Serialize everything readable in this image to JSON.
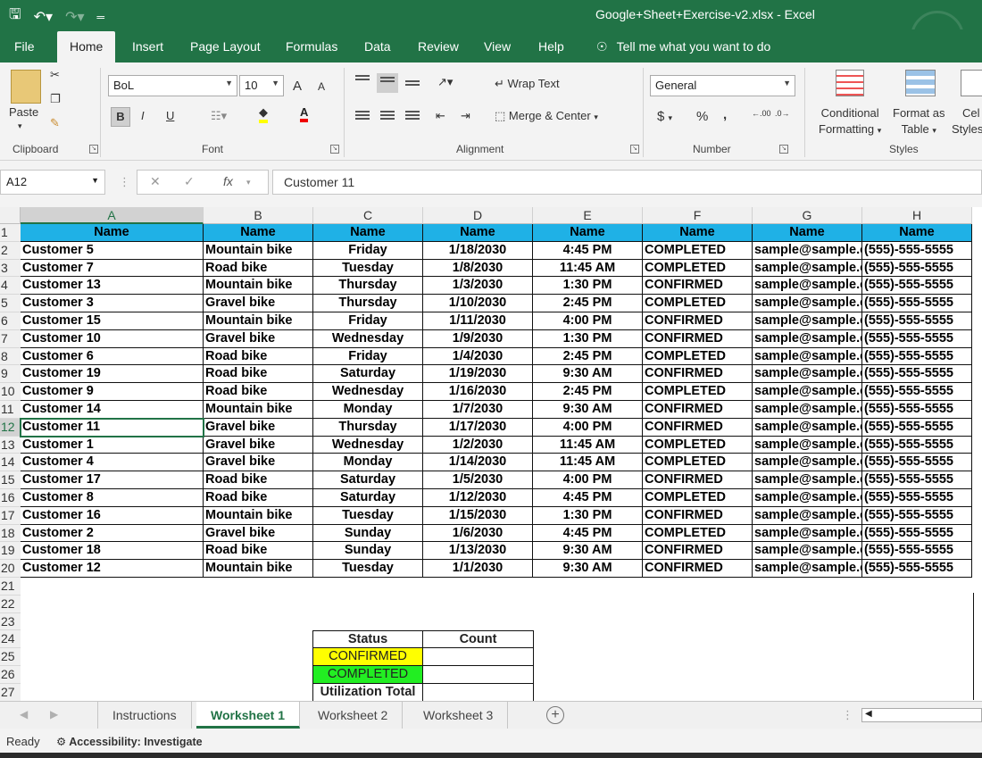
{
  "window": {
    "title": "Google+Sheet+Exercise-v2.xlsx  -  Excel"
  },
  "tabs": [
    "File",
    "Home",
    "Insert",
    "Page Layout",
    "Formulas",
    "Data",
    "Review",
    "View",
    "Help"
  ],
  "tell_me": "Tell me what you want to do",
  "ribbon": {
    "clipboard": {
      "paste": "Paste",
      "label": "Clipboard"
    },
    "font": {
      "name": "BoL",
      "size": "10",
      "label": "Font",
      "bold": "B",
      "italic": "I",
      "underline": "U",
      "grow": "A",
      "shrink": "A"
    },
    "alignment": {
      "wrap": "Wrap Text",
      "merge": "Merge & Center",
      "label": "Alignment"
    },
    "number": {
      "format": "General",
      "currency": "$",
      "percent": "%",
      "comma": ",",
      "inc": ".00",
      "dec": ".0",
      "label": "Number"
    },
    "styles": {
      "cond1": "Conditional",
      "cond2": "Formatting",
      "fmt1": "Format as",
      "fmt2": "Table",
      "cell1": "Cel",
      "cell2": "Styles",
      "label": "Styles"
    }
  },
  "formula_bar": {
    "cell_ref": "A12",
    "fx": "fx",
    "content": "Customer 11"
  },
  "columns": [
    "A",
    "B",
    "C",
    "D",
    "E",
    "F",
    "G",
    "H"
  ],
  "selected_column": "A",
  "selected_row": 12,
  "header_row": [
    "Name",
    "Name",
    "Name",
    "Name",
    "Name",
    "Name",
    "Name",
    "Name"
  ],
  "rows": [
    [
      "Customer 5",
      "Mountain bike",
      "Friday",
      "1/18/2030",
      "4:45 PM",
      "COMPLETED",
      "sample@sample.com",
      "(555)-555-5555"
    ],
    [
      "Customer 7",
      "Road bike",
      "Tuesday",
      "1/8/2030",
      "11:45 AM",
      "COMPLETED",
      "sample@sample.com",
      "(555)-555-5555"
    ],
    [
      "Customer 13",
      "Mountain bike",
      "Thursday",
      "1/3/2030",
      "1:30 PM",
      "CONFIRMED",
      "sample@sample.com",
      "(555)-555-5555"
    ],
    [
      "Customer 3",
      "Gravel bike",
      "Thursday",
      "1/10/2030",
      "2:45 PM",
      "COMPLETED",
      "sample@sample.com",
      "(555)-555-5555"
    ],
    [
      "Customer 15",
      "Mountain bike",
      "Friday",
      "1/11/2030",
      "4:00 PM",
      "CONFIRMED",
      "sample@sample.com",
      "(555)-555-5555"
    ],
    [
      "Customer 10",
      "Gravel bike",
      "Wednesday",
      "1/9/2030",
      "1:30 PM",
      "CONFIRMED",
      "sample@sample.com",
      "(555)-555-5555"
    ],
    [
      "Customer 6",
      "Road bike",
      "Friday",
      "1/4/2030",
      "2:45 PM",
      "COMPLETED",
      "sample@sample.com",
      "(555)-555-5555"
    ],
    [
      "Customer 19",
      "Road bike",
      "Saturday",
      "1/19/2030",
      "9:30 AM",
      "CONFIRMED",
      "sample@sample.com",
      "(555)-555-5555"
    ],
    [
      "Customer 9",
      "Road bike",
      "Wednesday",
      "1/16/2030",
      "2:45 PM",
      "COMPLETED",
      "sample@sample.com",
      "(555)-555-5555"
    ],
    [
      "Customer 14",
      "Mountain bike",
      "Monday",
      "1/7/2030",
      "9:30 AM",
      "CONFIRMED",
      "sample@sample.com",
      "(555)-555-5555"
    ],
    [
      "Customer 11",
      "Gravel bike",
      "Thursday",
      "1/17/2030",
      "4:00 PM",
      "CONFIRMED",
      "sample@sample.com",
      "(555)-555-5555"
    ],
    [
      "Customer 1",
      "Gravel bike",
      "Wednesday",
      "1/2/2030",
      "11:45 AM",
      "COMPLETED",
      "sample@sample.com",
      "(555)-555-5555"
    ],
    [
      "Customer 4",
      "Gravel bike",
      "Monday",
      "1/14/2030",
      "11:45 AM",
      "COMPLETED",
      "sample@sample.com",
      "(555)-555-5555"
    ],
    [
      "Customer 17",
      "Road bike",
      "Saturday",
      "1/5/2030",
      "4:00 PM",
      "CONFIRMED",
      "sample@sample.com",
      "(555)-555-5555"
    ],
    [
      "Customer 8",
      "Road bike",
      "Saturday",
      "1/12/2030",
      "4:45 PM",
      "COMPLETED",
      "sample@sample.com",
      "(555)-555-5555"
    ],
    [
      "Customer 16",
      "Mountain bike",
      "Tuesday",
      "1/15/2030",
      "1:30 PM",
      "CONFIRMED",
      "sample@sample.com",
      "(555)-555-5555"
    ],
    [
      "Customer 2",
      "Gravel bike",
      "Sunday",
      "1/6/2030",
      "4:45 PM",
      "COMPLETED",
      "sample@sample.com",
      "(555)-555-5555"
    ],
    [
      "Customer 18",
      "Road bike",
      "Sunday",
      "1/13/2030",
      "9:30 AM",
      "CONFIRMED",
      "sample@sample.com",
      "(555)-555-5555"
    ],
    [
      "Customer 12",
      "Mountain bike",
      "Tuesday",
      "1/1/2030",
      "9:30 AM",
      "CONFIRMED",
      "sample@sample.com",
      "(555)-555-5555"
    ]
  ],
  "row_numbers": [
    1,
    2,
    3,
    4,
    5,
    6,
    7,
    8,
    9,
    10,
    11,
    12,
    13,
    14,
    15,
    16,
    17,
    18,
    19,
    20,
    21,
    22,
    23,
    24,
    25,
    26,
    27
  ],
  "summary": {
    "header": [
      "Status",
      "Count"
    ],
    "rows": [
      {
        "label": "CONFIRMED",
        "value": "",
        "color": "#ffff00"
      },
      {
        "label": "COMPLETED",
        "value": "",
        "color": "#22ee22"
      },
      {
        "label": "Utilization Total",
        "value": "",
        "color": "#ffffff"
      }
    ]
  },
  "sheets": [
    "Instructions",
    "Worksheet 1",
    "Worksheet 2",
    "Worksheet 3"
  ],
  "active_sheet": "Worksheet 1",
  "status": {
    "ready": "Ready",
    "accessibility": "Accessibility: Investigate"
  },
  "colors": {
    "accent": "#217346",
    "header_fill": "#1fb1e6"
  }
}
